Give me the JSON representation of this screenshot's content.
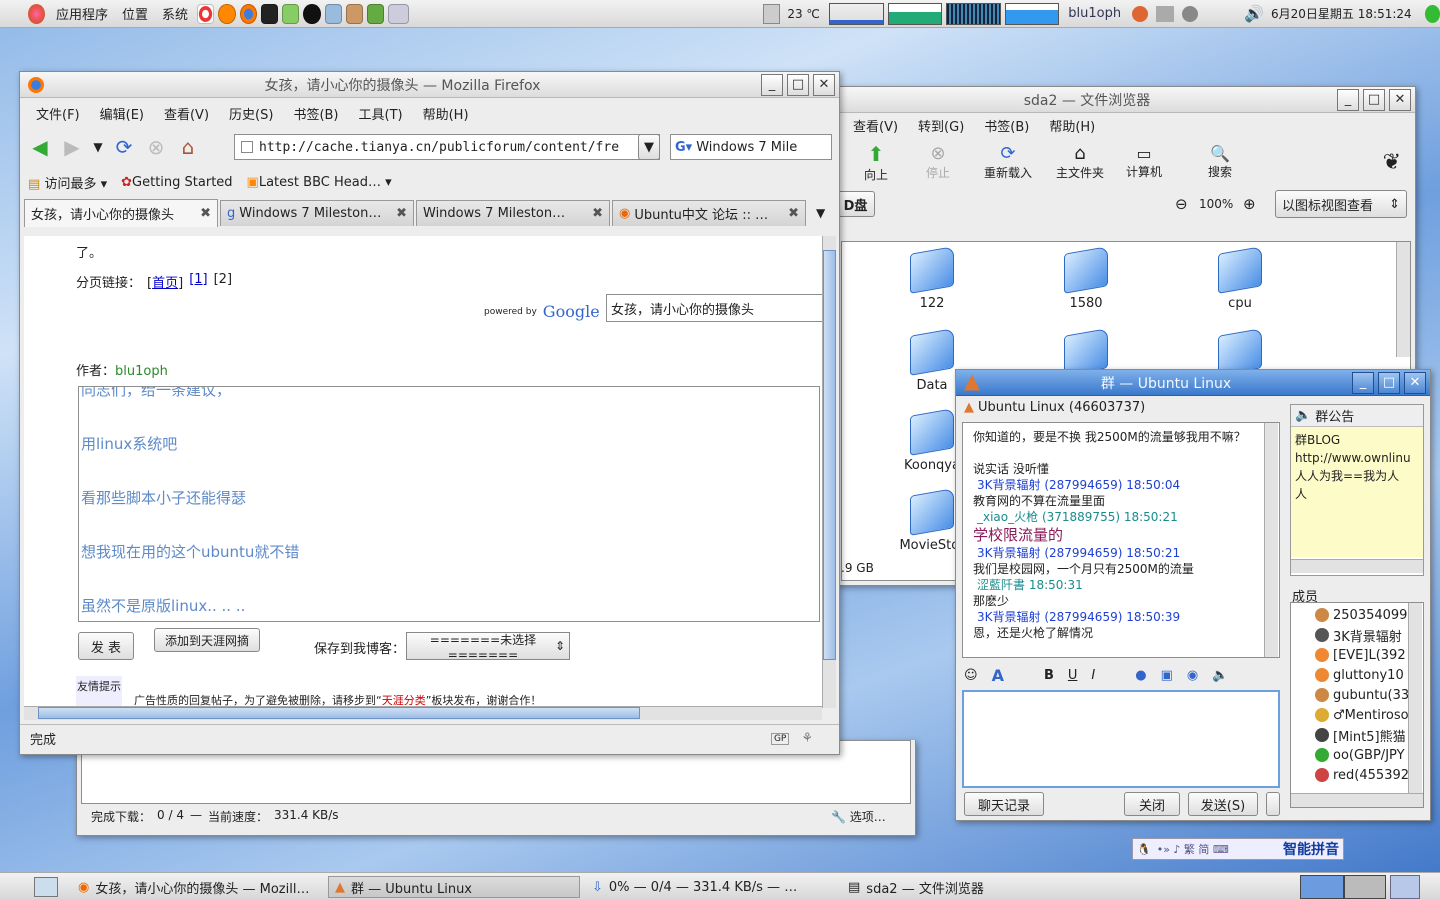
{
  "top_panel": {
    "menus": [
      "应用程序",
      "位置",
      "系统"
    ],
    "temp": "23 ℃",
    "user": "blu1oph",
    "clock": "6月20日星期五 18:51:24"
  },
  "firefox": {
    "title": "女孩，请小心你的摄像头 — Mozilla Firefox",
    "menu": [
      "文件(F)",
      "编辑(E)",
      "查看(V)",
      "历史(S)",
      "书签(B)",
      "工具(T)",
      "帮助(H)"
    ],
    "url": "http://cache.tianya.cn/publicforum/content/fre",
    "search": "Windows 7 Mile",
    "bookmarks": [
      "访问最多",
      "Getting Started",
      "Latest BBC Head…"
    ],
    "tabs": [
      "女孩，请小心你的摄像头",
      "Windows 7 Mileston…",
      "Windows 7 Mileston…",
      "Ubuntu中文 论坛 :: …"
    ],
    "page": {
      "frag": "了。",
      "pagelinks_label": "分页链接：",
      "pagelinks": [
        "首页",
        "[1]",
        "[2]"
      ],
      "powered": "powered by",
      "google": "Google",
      "search_value": "女孩，请小心你的摄像头",
      "author_label": "作者：",
      "author": "blu1oph",
      "reply_lines": [
        "同志们，给一条建议，",
        "用linux系统吧",
        "看那些脚本小子还能得瑟",
        "想我现在用的这个ubuntu就不错",
        "虽然不是原版linux.. .. .."
      ],
      "btn_post": "发 表",
      "btn_save": "添加到天涯网摘",
      "blog_label": "保存到我博客：",
      "blog_select": "=======未选择=======",
      "tip_label": "友情提示",
      "tip_text": "广告性质的回复帖子，为了避免被删除，请移步到“",
      "tip_link": "天涯分类",
      "tip_text2": "”板块发布，谢谢合作！"
    },
    "status": "完成"
  },
  "nautilus": {
    "title": "sda2 — 文件浏览器",
    "menu": [
      "查看(V)",
      "转到(G)",
      "书签(B)",
      "帮助(H)"
    ],
    "tools": [
      "向上",
      "停止",
      "重新载入",
      "主文件夹",
      "计算机",
      "搜索"
    ],
    "path_btn": "D盘",
    "zoom": "100%",
    "view": "以图标视图查看",
    "folders": [
      "122",
      "1580",
      "cpu",
      "Data",
      "",
      "",
      "Koonqya",
      "MovieStor"
    ],
    "free": ".9 GB"
  },
  "download": {
    "done_label": "完成下载：",
    "done": "0 / 4",
    "speed_label": "当前速度：",
    "speed": "331.4 KB/s",
    "options": "选项…"
  },
  "qq": {
    "title": "群 — Ubuntu Linux",
    "group": "Ubuntu Linux (46603737)",
    "messages": [
      {
        "t": "text",
        "v": "你知道的，要是不换  我2500M的流量够我用不嘛？"
      },
      {
        "t": "text",
        "v": ""
      },
      {
        "t": "text",
        "v": "说实话   没听懂"
      },
      {
        "t": "nick",
        "v": "3K背景辐射 (287994659) 18:50:04"
      },
      {
        "t": "text",
        "v": "教育网的不算在流量里面"
      },
      {
        "t": "nick2",
        "v": "_xiao_火枪 (371889755) 18:50:21"
      },
      {
        "t": "big",
        "v": "学校限流量的"
      },
      {
        "t": "nick",
        "v": "3K背景辐射 (287994659) 18:50:21"
      },
      {
        "t": "text",
        "v": "我们是校园网，一个月只有2500M的流量"
      },
      {
        "t": "nick2",
        "v": "涩藍阡書 18:50:31"
      },
      {
        "t": "text",
        "v": "那麽少"
      },
      {
        "t": "nick",
        "v": "3K背景辐射 (287994659) 18:50:39"
      },
      {
        "t": "text",
        "v": "恩，还是火枪了解情况"
      }
    ],
    "notice_title": "群公告",
    "notice": [
      "群BLOG",
      "http://www.ownlinu",
      "人人为我==我为人",
      "人"
    ],
    "members_label": "成员",
    "members": [
      "250354099",
      "3K背景辐射",
      "[EVE]L(392",
      "gluttony10",
      "gubuntu(33",
      "♂Mentiroso",
      "[Mint5]熊猫",
      "oo(GBP/JPY",
      "red(455392"
    ],
    "btn_history": "聊天记录",
    "btn_close": "关闭",
    "btn_send": "发送(S)"
  },
  "ime": "智能拼音",
  "taskbar": [
    "女孩，请小心你的摄像头 — Mozill…",
    "群 — Ubuntu Linux",
    "0% — 0/4 — 331.4 KB/s — …",
    "sda2 — 文件浏览器"
  ]
}
